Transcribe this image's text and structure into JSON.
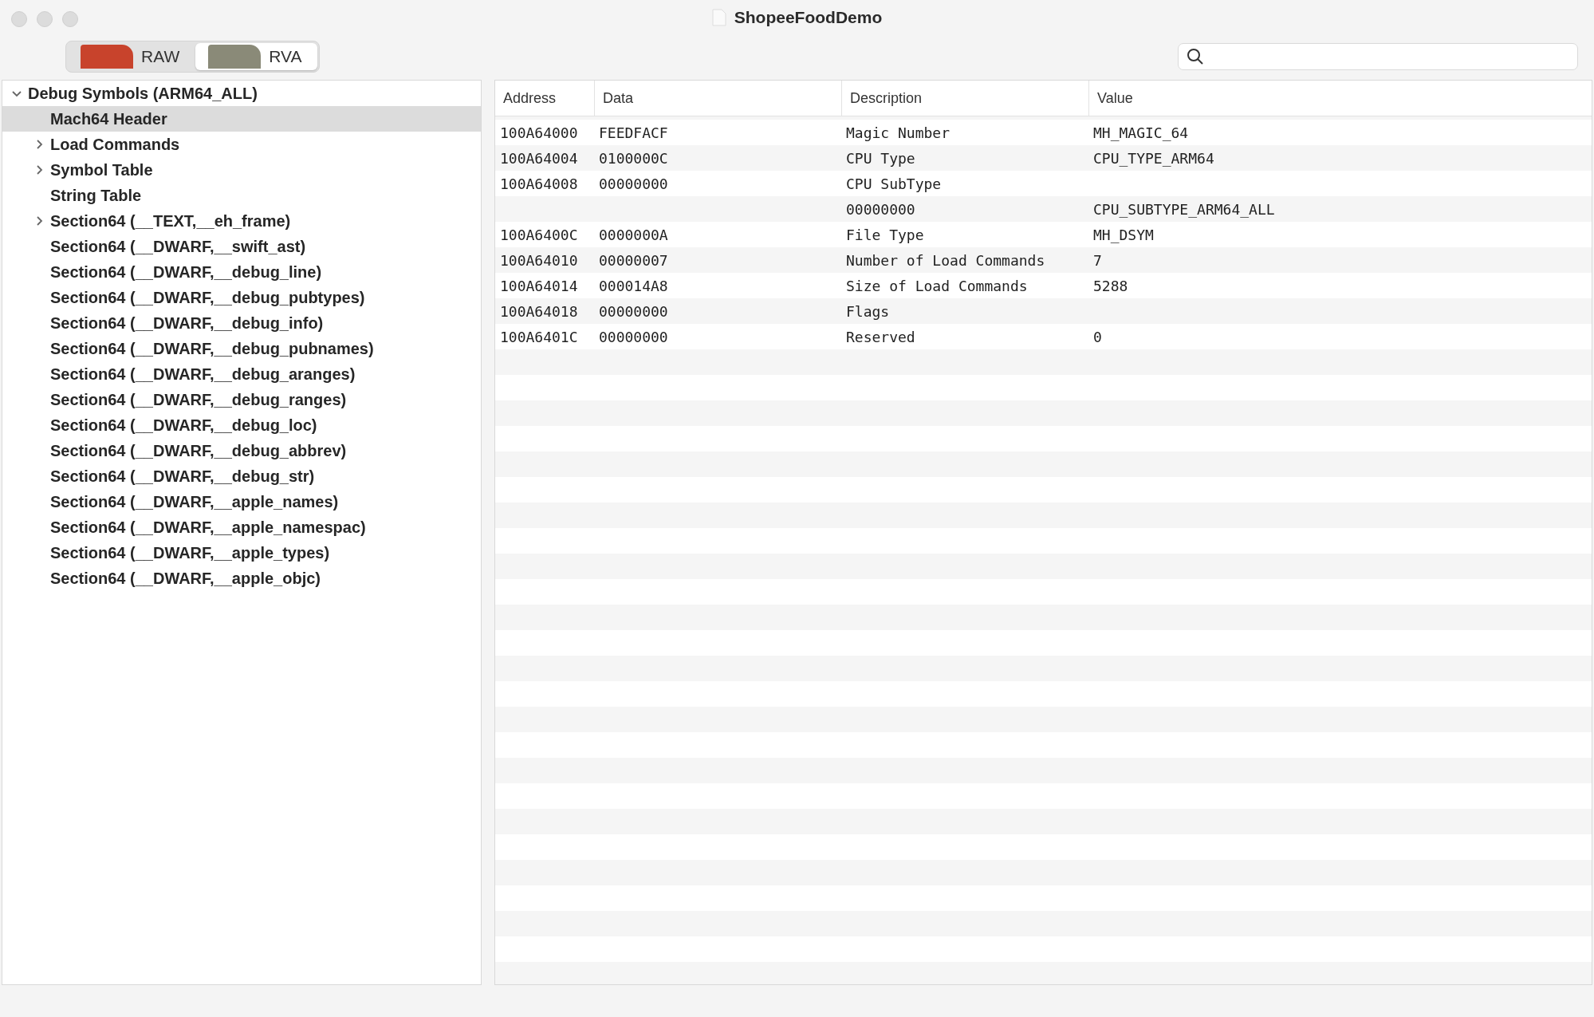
{
  "window": {
    "title": "ShopeeFoodDemo"
  },
  "toolbar": {
    "segments": [
      {
        "label": "RAW",
        "selected": false
      },
      {
        "label": "RVA",
        "selected": true
      }
    ]
  },
  "tree": {
    "items": [
      {
        "label": "Debug Symbols (ARM64_ALL)",
        "expanded": true,
        "selected": false,
        "children": [
          {
            "label": "Mach64 Header",
            "selected": true
          },
          {
            "label": "Load Commands",
            "expanded": false,
            "selected": false
          },
          {
            "label": "Symbol Table",
            "expanded": false,
            "selected": false
          },
          {
            "label": "String Table",
            "selected": false
          },
          {
            "label": "Section64 (__TEXT,__eh_frame)",
            "expanded": false,
            "selected": false
          },
          {
            "label": "Section64 (__DWARF,__swift_ast)",
            "selected": false
          },
          {
            "label": "Section64 (__DWARF,__debug_line)",
            "selected": false
          },
          {
            "label": "Section64 (__DWARF,__debug_pubtypes)",
            "selected": false
          },
          {
            "label": "Section64 (__DWARF,__debug_info)",
            "selected": false
          },
          {
            "label": "Section64 (__DWARF,__debug_pubnames)",
            "selected": false
          },
          {
            "label": "Section64 (__DWARF,__debug_aranges)",
            "selected": false
          },
          {
            "label": "Section64 (__DWARF,__debug_ranges)",
            "selected": false
          },
          {
            "label": "Section64 (__DWARF,__debug_loc)",
            "selected": false
          },
          {
            "label": "Section64 (__DWARF,__debug_abbrev)",
            "selected": false
          },
          {
            "label": "Section64 (__DWARF,__debug_str)",
            "selected": false
          },
          {
            "label": "Section64 (__DWARF,__apple_names)",
            "selected": false
          },
          {
            "label": "Section64 (__DWARF,__apple_namespac)",
            "selected": false
          },
          {
            "label": "Section64 (__DWARF,__apple_types)",
            "selected": false
          },
          {
            "label": "Section64 (__DWARF,__apple_objc)",
            "selected": false
          }
        ]
      }
    ]
  },
  "table": {
    "columns": [
      "Address",
      "Data",
      "Description",
      "Value"
    ],
    "rows": [
      [
        "100A64000",
        "FEEDFACF",
        "Magic Number",
        "MH_MAGIC_64"
      ],
      [
        "100A64004",
        "0100000C",
        "CPU Type",
        "CPU_TYPE_ARM64"
      ],
      [
        "100A64008",
        "00000000",
        "CPU SubType",
        null
      ],
      [
        null,
        null,
        "00000000",
        "CPU_SUBTYPE_ARM64_ALL"
      ],
      [
        "100A6400C",
        "0000000A",
        "File Type",
        "MH_DSYM"
      ],
      [
        "100A64010",
        "00000007",
        "Number of Load Commands",
        "7"
      ],
      [
        "100A64014",
        "000014A8",
        "Size of Load Commands",
        "5288"
      ],
      [
        "100A64018",
        "00000000",
        "Flags",
        null
      ],
      [
        "100A6401C",
        "00000000",
        "Reserved",
        "0"
      ]
    ]
  }
}
